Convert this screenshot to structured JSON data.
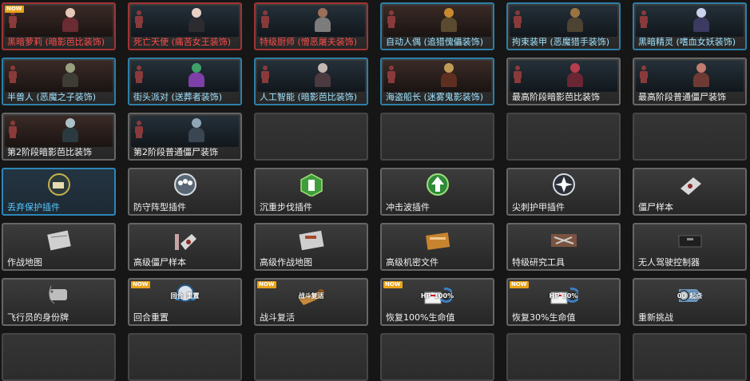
{
  "tiles": [
    {
      "label": "黑暗萝莉 (暗影芭比装饰)",
      "type": "char",
      "border": "red",
      "badge": "NOW",
      "figure": {
        "head": "#e6c7b8",
        "body": "#6a2b33"
      }
    },
    {
      "label": "死亡天使 (痛苦女王装饰)",
      "type": "char",
      "border": "red",
      "figure": {
        "head": "#e8d0c4",
        "body": "#2b2b30"
      }
    },
    {
      "label": "特级厨师 (憎恶屠夫装饰)",
      "type": "char",
      "border": "red",
      "figure": {
        "head": "#9c6f5a",
        "body": "#7c7c7c"
      }
    },
    {
      "label": "自动人偶 (追猎傀儡装饰)",
      "type": "char",
      "border": "blue",
      "figure": {
        "head": "#c9892f",
        "body": "#5a4a2e"
      }
    },
    {
      "label": "拘束装甲 (恶魔猎手装饰)",
      "type": "char",
      "border": "blue",
      "figure": {
        "head": "#9a7440",
        "body": "#4d4333"
      }
    },
    {
      "label": "黑暗精灵 (嗜血女妖装饰)",
      "type": "char",
      "border": "blue",
      "figure": {
        "head": "#c9d3ea",
        "body": "#3b3a60"
      }
    },
    {
      "label": "半兽人 (恶魔之子装饰)",
      "type": "char",
      "border": "blue",
      "figure": {
        "head": "#9aa07e",
        "body": "#3d3c35"
      }
    },
    {
      "label": "街头派对 (送葬者装饰)",
      "type": "char",
      "border": "blue",
      "figure": {
        "head": "#3fa06a",
        "body": "#7f3fa8"
      }
    },
    {
      "label": "人工智能 (暗影芭比装饰)",
      "type": "char",
      "border": "blue",
      "figure": {
        "head": "#c3b6b0",
        "body": "#4b3a40"
      }
    },
    {
      "label": "海盗船长 (迷雾鬼影装饰)",
      "type": "char",
      "border": "blue",
      "figure": {
        "head": "#c29a58",
        "body": "#5e2f20"
      }
    },
    {
      "label": "最高阶段暗影芭比装饰",
      "type": "char",
      "border": "gray",
      "figure": {
        "head": "#b53d4e",
        "body": "#6b2633"
      }
    },
    {
      "label": "最高阶段普通僵尸装饰",
      "type": "char",
      "border": "gray",
      "figure": {
        "head": "#c07c6d",
        "body": "#6e3b34"
      }
    },
    {
      "label": "第2阶段暗影芭比装饰",
      "type": "char",
      "border": "gray",
      "figure": {
        "head": "#aac2c7",
        "body": "#2a3a40"
      }
    },
    {
      "label": "第2阶段普通僵尸装饰",
      "type": "char",
      "border": "gray",
      "figure": {
        "head": "#8fa6b6",
        "body": "#3a4652"
      }
    },
    {
      "label": "",
      "type": "empty"
    },
    {
      "label": "",
      "type": "empty"
    },
    {
      "label": "",
      "type": "empty"
    },
    {
      "label": "",
      "type": "empty"
    },
    {
      "label": "丢弃保护插件",
      "type": "icon",
      "icon": "abandon-plugin",
      "border": "sel"
    },
    {
      "label": "防守阵型插件",
      "type": "icon",
      "icon": "defense-plugin",
      "border": "gray"
    },
    {
      "label": "沉重步伐插件",
      "type": "icon",
      "icon": "heavy-step-plugin",
      "border": "gray"
    },
    {
      "label": "冲击波插件",
      "type": "icon",
      "icon": "shockwave-plugin",
      "border": "gray"
    },
    {
      "label": "尖刺护甲插件",
      "type": "icon",
      "icon": "spike-armor-plugin",
      "border": "gray"
    },
    {
      "label": "僵尸样本",
      "type": "icon",
      "icon": "zombie-sample",
      "border": "gray"
    },
    {
      "label": "作战地图",
      "type": "icon",
      "icon": "battle-map",
      "border": "gray"
    },
    {
      "label": "高级僵尸样本",
      "type": "icon",
      "icon": "adv-zombie-sample",
      "border": "gray"
    },
    {
      "label": "高级作战地图",
      "type": "icon",
      "icon": "adv-battle-map",
      "border": "gray"
    },
    {
      "label": "高级机密文件",
      "type": "icon",
      "icon": "secret-file",
      "border": "gray"
    },
    {
      "label": "特级研究工具",
      "type": "icon",
      "icon": "research-tools",
      "border": "gray"
    },
    {
      "label": "无人驾驶控制器",
      "type": "icon",
      "icon": "drone-controller",
      "border": "gray"
    },
    {
      "label": "飞行员的身份牌",
      "type": "icon",
      "icon": "dog-tag",
      "border": "gray"
    },
    {
      "label": "回合重置",
      "type": "icon",
      "icon": "round-reset",
      "border": "gray",
      "badge": "NOW",
      "art_text": [
        "回合",
        "重置"
      ]
    },
    {
      "label": "战斗复活",
      "type": "icon",
      "icon": "revive",
      "border": "gray",
      "badge": "NOW",
      "art_text": [
        "战斗复活"
      ]
    },
    {
      "label": "恢复100%生命值",
      "type": "icon",
      "icon": "hp-100",
      "border": "gray",
      "badge": "NOW",
      "art_text": [
        "HP",
        "100%"
      ]
    },
    {
      "label": "恢复30%生命值",
      "type": "icon",
      "icon": "hp-30",
      "border": "gray",
      "badge": "NOW",
      "art_text": [
        "HP",
        "30%"
      ]
    },
    {
      "label": "重新挑战",
      "type": "icon",
      "icon": "rechallenge",
      "border": "gray",
      "art_text": [
        "00",
        "起点"
      ]
    },
    {
      "label": "",
      "type": "empty"
    },
    {
      "label": "",
      "type": "empty"
    },
    {
      "label": "",
      "type": "empty"
    },
    {
      "label": "",
      "type": "empty"
    },
    {
      "label": "",
      "type": "empty"
    },
    {
      "label": "",
      "type": "empty"
    }
  ],
  "colors": {
    "red_label": "#ff4c4c",
    "blue_label": "#9fe3ff",
    "selected_label": "#55c8ff",
    "badge": "#e8a21a"
  }
}
